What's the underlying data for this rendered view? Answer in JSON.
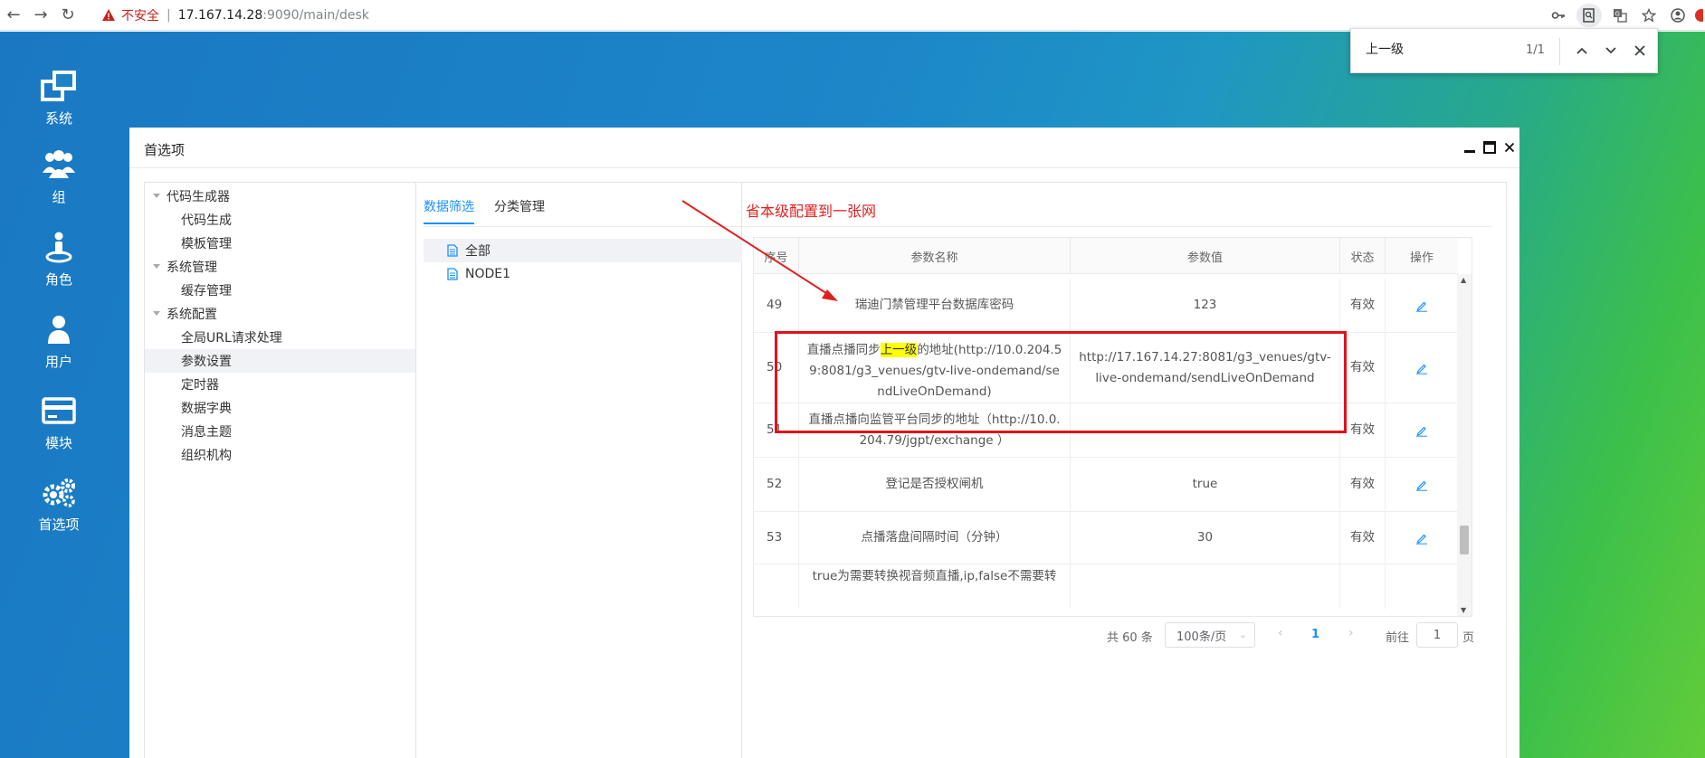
{
  "browser": {
    "back": "←",
    "forward": "→",
    "reload": "↻",
    "insecure_label": "不安全",
    "url_host": "17.167.14.28",
    "url_path": ":9090/main/desk"
  },
  "sidebar": {
    "items": [
      {
        "label": "系统",
        "icon": "windows-icon"
      },
      {
        "label": "组",
        "icon": "group-icon"
      },
      {
        "label": "角色",
        "icon": "role-icon"
      },
      {
        "label": "用户",
        "icon": "user-icon"
      },
      {
        "label": "模块",
        "icon": "card-icon"
      },
      {
        "label": "首选项",
        "icon": "gears-icon"
      }
    ]
  },
  "findbar": {
    "query": "上一级",
    "count": "1/1"
  },
  "window": {
    "title": "首选项"
  },
  "tree": {
    "items": [
      {
        "label": "代码生成器",
        "level": 0
      },
      {
        "label": "代码生成",
        "level": 1
      },
      {
        "label": "模板管理",
        "level": 1
      },
      {
        "label": "系统管理",
        "level": 0
      },
      {
        "label": "缓存管理",
        "level": 1
      },
      {
        "label": "系统配置",
        "level": 0
      },
      {
        "label": "全局URL请求处理",
        "level": 1
      },
      {
        "label": "参数设置",
        "level": 1,
        "selected": true
      },
      {
        "label": "定时器",
        "level": 1
      },
      {
        "label": "数据字典",
        "level": 1
      },
      {
        "label": "消息主题",
        "level": 1
      },
      {
        "label": "组织机构",
        "level": 1
      }
    ]
  },
  "tabs": [
    {
      "label": "数据筛选",
      "active": true
    },
    {
      "label": "分类管理",
      "active": false
    }
  ],
  "filters": [
    {
      "label": "全部",
      "selected": true
    },
    {
      "label": "NODE1",
      "selected": false
    }
  ],
  "annotation": "省本级配置到一张网",
  "table": {
    "headers": [
      "序号",
      "参数名称",
      "参数值",
      "状态",
      "操作"
    ],
    "rows": [
      {
        "no": "49",
        "name": "瑞迪门禁管理平台数据库密码",
        "value": "123",
        "status": "有效"
      },
      {
        "no": "50",
        "name_before": "直播点播同步",
        "name_highlight": "上一级",
        "name_after": "的地址(http://10.0.204.59:8081/g3_venues/gtv-live-ondemand/sendLiveOnDemand)",
        "value": "http://17.167.14.27:8081/g3_venues/gtv-live-ondemand/sendLiveOnDemand",
        "status": "有效"
      },
      {
        "no": "51",
        "name": "直播点播向监管平台同步的地址（http://10.0.204.79/jgpt/exchange ）",
        "value": "",
        "status": "有效"
      },
      {
        "no": "52",
        "name": "登记是否授权闸机",
        "value": "true",
        "status": "有效"
      },
      {
        "no": "53",
        "name": "点播落盘间隔时间（分钟）",
        "value": "30",
        "status": "有效"
      },
      {
        "no": "",
        "name": "true为需要转换视音频直播,ip,false不需要转",
        "value": "",
        "status": ""
      }
    ]
  },
  "pagination": {
    "total": "共 60 条",
    "page_size": "100条/页",
    "current": "1",
    "goto_label": "前往",
    "goto_value": "1",
    "goto_unit": "页"
  },
  "colors": {
    "accent": "#1890ff",
    "annotation": "#e02020",
    "highlight": "#ffff00"
  }
}
